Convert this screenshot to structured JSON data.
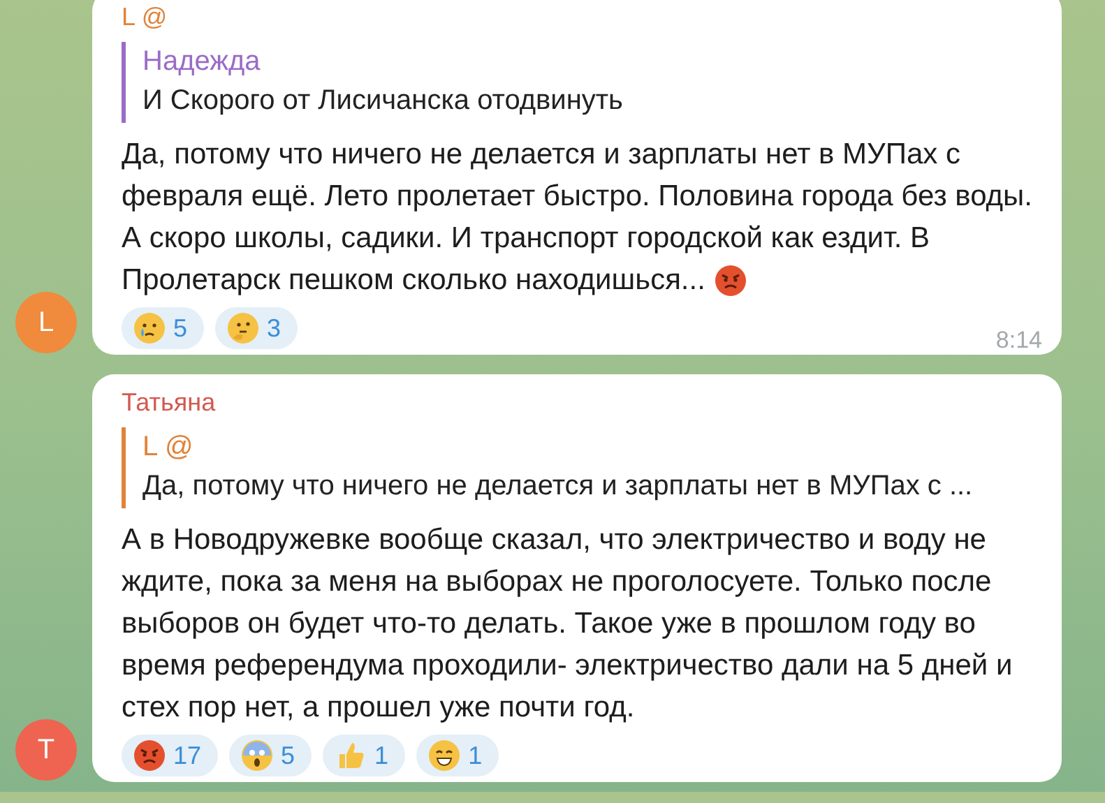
{
  "messages": [
    {
      "sender": {
        "name": "L @",
        "color": "#e0833a"
      },
      "avatar": {
        "letter": "L",
        "color": "#f08a3c"
      },
      "reply": {
        "author": "Надежда",
        "color": "#9b6cc6",
        "text": "И Скорого от Лисичанска отодвинуть"
      },
      "text": "Да, потому что ничего не делается и зарплаты нет в МУПах с февраля ещё. Лето пролетает быстро. Половина города без воды. А скоро школы, садики. И транспорт городской как ездит. В Пролетарск пешком сколько находишься...",
      "text_emoji": {
        "kind": "angry"
      },
      "reactions": [
        {
          "kind": "crying",
          "count": "5"
        },
        {
          "kind": "thinking",
          "count": "3"
        }
      ],
      "time": "8:14"
    },
    {
      "sender": {
        "name": "Татьяна",
        "color": "#d4574e"
      },
      "avatar": {
        "letter": "T",
        "color": "#ee6450"
      },
      "reply": {
        "author": "L @",
        "color": "#e0833a",
        "text": "Да, потому что ничего не делается и зарплаты нет в МУПах с ..."
      },
      "text": "А в Новодружевке вообще сказал, что  электричество и воду не ждите, пока за меня  на выборах не проголосуете. Только после выборов он будет что-то делать. Такое уже в прошлом году во время референдума проходили- электричество дали на 5 дней и стех пор нет, а прошел уже почти год.",
      "reactions": [
        {
          "kind": "angry",
          "count": "17"
        },
        {
          "kind": "scream",
          "count": "5"
        },
        {
          "kind": "thumbs-up",
          "count": "1"
        },
        {
          "kind": "grin",
          "count": "1"
        }
      ]
    }
  ]
}
